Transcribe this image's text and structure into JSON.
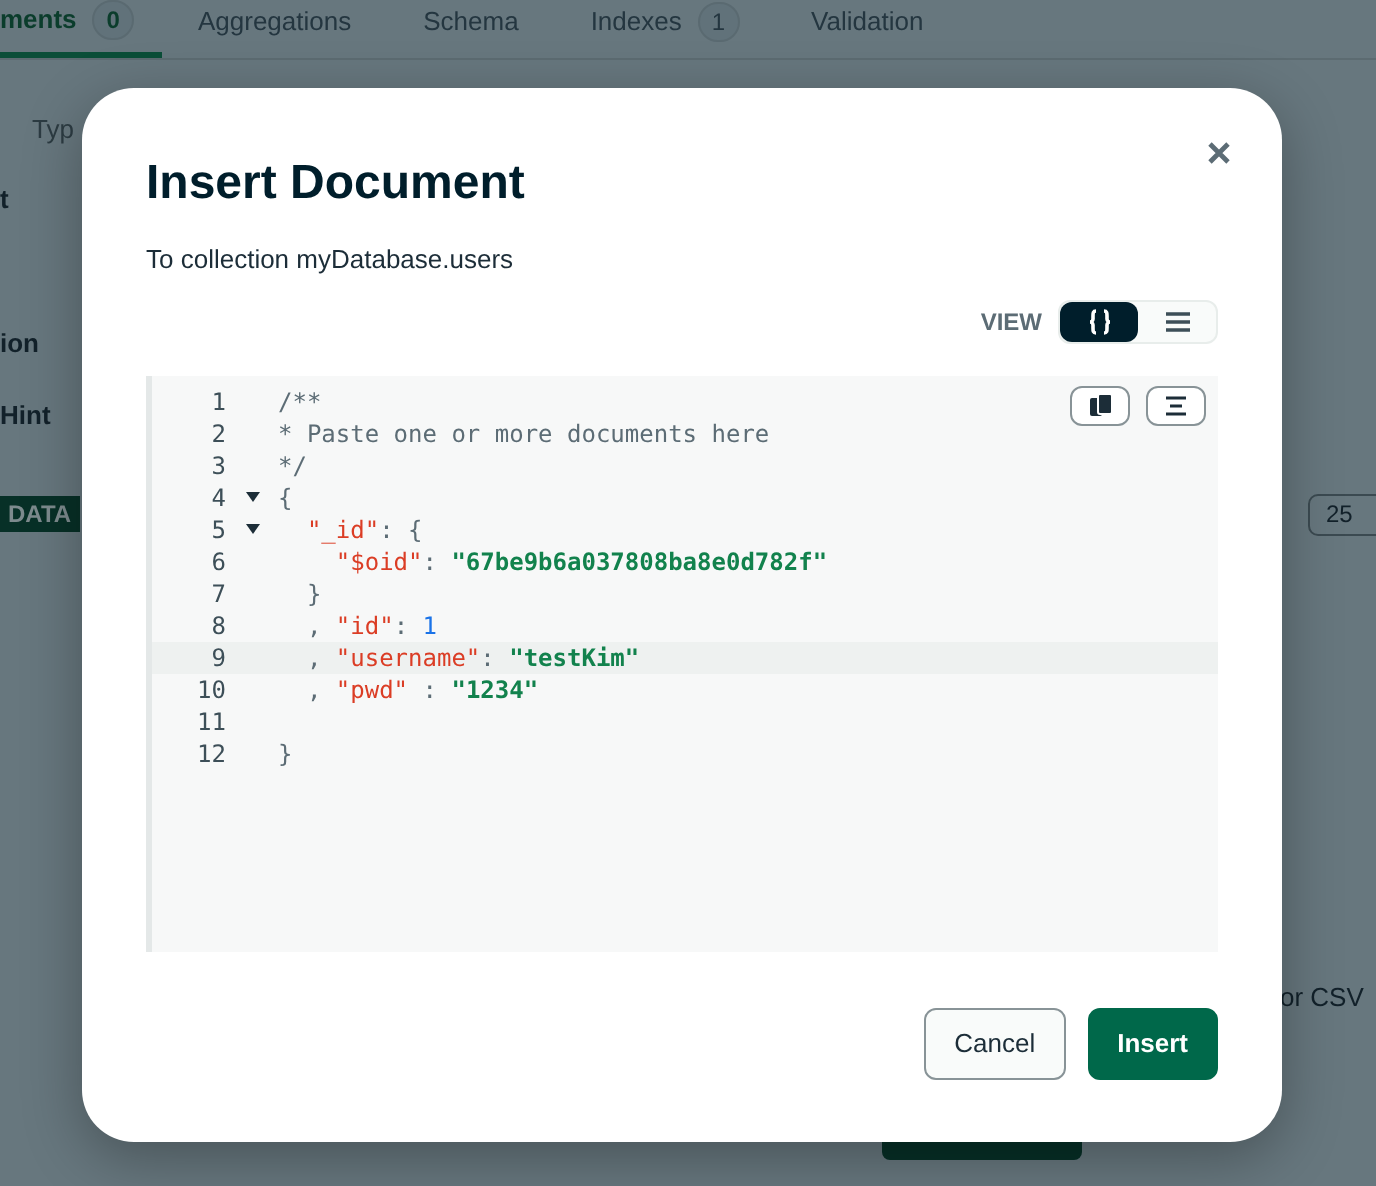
{
  "background": {
    "tabs": [
      {
        "label": "ments",
        "badge": "0",
        "selected": true
      },
      {
        "label": "Aggregations",
        "selected": false
      },
      {
        "label": "Schema",
        "selected": false
      },
      {
        "label": "Indexes",
        "badge": "1",
        "selected": false
      },
      {
        "label": "Validation",
        "selected": false
      }
    ],
    "filter_placeholder": "Typ",
    "side_labels": [
      "t",
      "ion",
      "Hint"
    ],
    "add_data_button": "DATA",
    "page_size": "25",
    "import_hint": "or CSV"
  },
  "dialog": {
    "title": "Insert Document",
    "subtitle": "To collection myDatabase.users",
    "view_label": "VIEW",
    "view_options": [
      {
        "kind": "json",
        "selected": true
      },
      {
        "kind": "list",
        "selected": false
      }
    ],
    "code_lines": [
      {
        "number": "1",
        "fold": false,
        "highlighted": false,
        "tokens": [
          {
            "kind": "comment",
            "text": "/**"
          }
        ]
      },
      {
        "number": "2",
        "fold": false,
        "highlighted": false,
        "tokens": [
          {
            "kind": "comment",
            "text": "* Paste one or more documents here"
          }
        ]
      },
      {
        "number": "3",
        "fold": false,
        "highlighted": false,
        "tokens": [
          {
            "kind": "comment",
            "text": "*/"
          }
        ]
      },
      {
        "number": "4",
        "fold": true,
        "highlighted": false,
        "tokens": [
          {
            "kind": "punct",
            "text": "{"
          }
        ]
      },
      {
        "number": "5",
        "fold": true,
        "highlighted": false,
        "tokens": [
          {
            "kind": "key",
            "text": "  \"_id\""
          },
          {
            "kind": "punct",
            "text": ": {"
          }
        ]
      },
      {
        "number": "6",
        "fold": false,
        "highlighted": false,
        "tokens": [
          {
            "kind": "key",
            "text": "    \"$oid\""
          },
          {
            "kind": "punct",
            "text": ": "
          },
          {
            "kind": "string",
            "text": "\"67be9b6a037808ba8e0d782f\""
          }
        ]
      },
      {
        "number": "7",
        "fold": false,
        "highlighted": false,
        "tokens": [
          {
            "kind": "punct",
            "text": "  }"
          }
        ]
      },
      {
        "number": "8",
        "fold": false,
        "highlighted": false,
        "tokens": [
          {
            "kind": "punct",
            "text": "  , "
          },
          {
            "kind": "key",
            "text": "\"id\""
          },
          {
            "kind": "punct",
            "text": ": "
          },
          {
            "kind": "number",
            "text": "1"
          }
        ]
      },
      {
        "number": "9",
        "fold": false,
        "highlighted": true,
        "tokens": [
          {
            "kind": "punct",
            "text": "  , "
          },
          {
            "kind": "key",
            "text": "\"username\""
          },
          {
            "kind": "punct",
            "text": ": "
          },
          {
            "kind": "string",
            "text": "\"testKim\""
          }
        ]
      },
      {
        "number": "10",
        "fold": false,
        "highlighted": false,
        "tokens": [
          {
            "kind": "punct",
            "text": "  , "
          },
          {
            "kind": "key",
            "text": "\"pwd\""
          },
          {
            "kind": "punct",
            "text": " : "
          },
          {
            "kind": "string",
            "text": "\"1234\""
          }
        ]
      },
      {
        "number": "11",
        "fold": false,
        "highlighted": false
      },
      {
        "number": "12",
        "fold": false,
        "highlighted": false,
        "tokens": [
          {
            "kind": "punct",
            "text": "}"
          }
        ]
      }
    ],
    "buttons": [
      {
        "kind": "secondary",
        "label": "Cancel"
      },
      {
        "kind": "primary",
        "label": "Insert"
      }
    ]
  }
}
